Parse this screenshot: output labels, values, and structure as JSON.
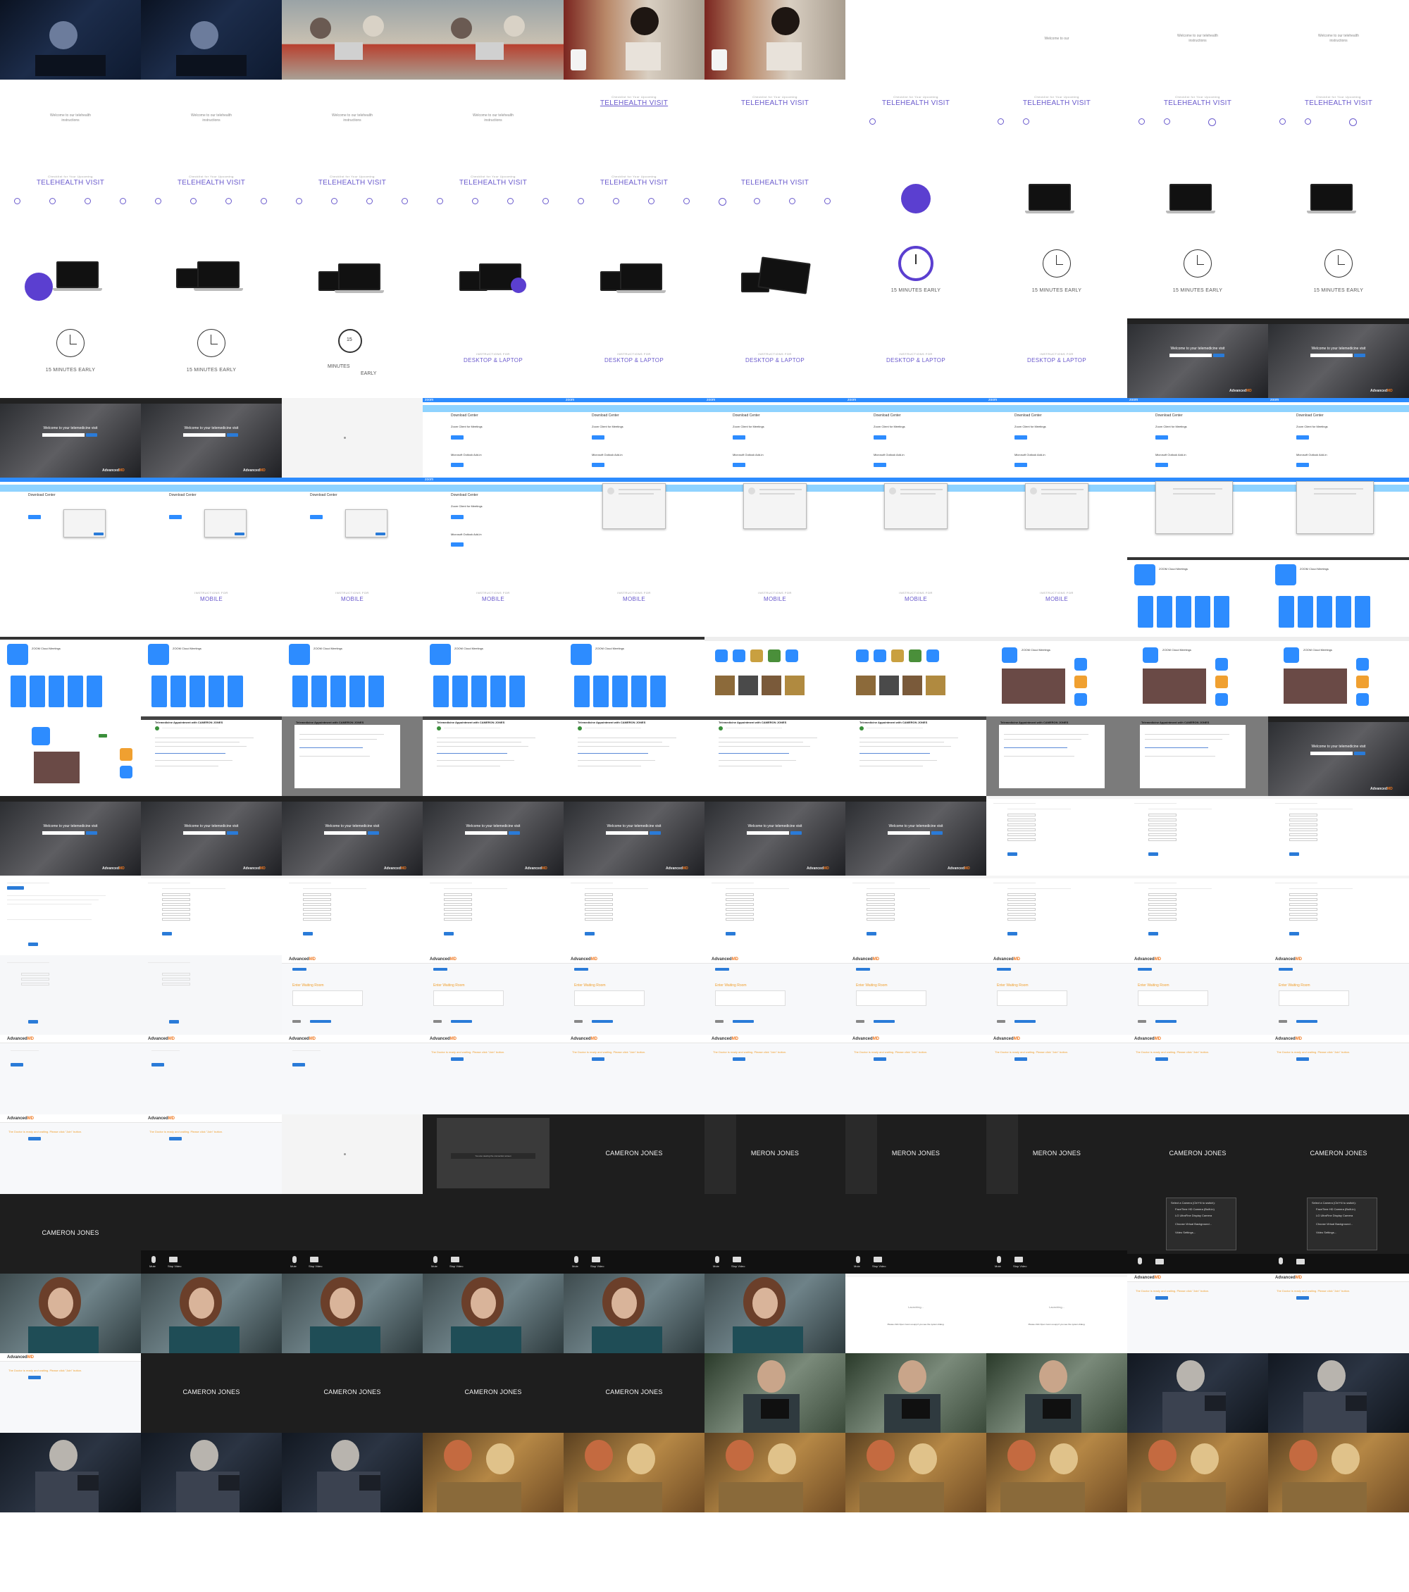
{
  "texts": {
    "welcome_short": "Welcome to our",
    "welcome_full": "Welcome to our telehealth instructions",
    "checklist_pre": "Checklist for Your Upcoming",
    "telehealth_visit": "TELEHEALTH VISIT",
    "fifteen_early": "15 MINUTES EARLY",
    "fifteen": "15",
    "minutes": "MINUTES",
    "early": "EARLY",
    "instructions_for": "INSTRUCTIONS FOR",
    "desktop_laptop": "DESKTOP & LAPTOP",
    "mobile": "MOBILE",
    "welcome_tele_site": "Welcome to your telemedicine visit",
    "zoom": "zoom",
    "download_center": "Download Center",
    "zoom_client": "Zoom Client for Meetings",
    "outlook_addin": "Microsoft Outlook Add-in",
    "zoom_cloud": "ZOOM Cloud Meetings",
    "appointment": "Telemedicine Appointment with CAMERON JONES",
    "advancedmd_a": "Advanced",
    "advancedmd_b": "MD",
    "enter_waiting_room": "Enter Waiting Room",
    "doctor_ready": "The Doctor is ready and waiting. Please click \"Join\" button.",
    "cameron_jones": "CAMERON JONES",
    "cameron_partial": "MERON JONES",
    "select_camera": "Select a Camera (Ctrl+N to switch):",
    "facetime": "FaceTime HD Camera (Built-in)",
    "lg_camera": "LG UltraFine Display Camera",
    "virtual_bg": "Choose Virtual Background...",
    "video_settings": "Video Settings...",
    "mute": "Mute",
    "stop_video": "Stop Video",
    "launching": "Launching...",
    "launch_hint": "Please click Open zoom.us.app if you see the system dialog.",
    "start_meeting_hint": "You are viewing the connection screen",
    "join": "Join"
  },
  "colors": {
    "accent_purple": "#6a5acd",
    "zoom_blue": "#2d8cff",
    "amd_orange": "#f07820",
    "dark_ui": "#1e1e1e"
  },
  "icons": [
    "check-circle-icon",
    "clock-icon",
    "laptop-icon",
    "phone-icon",
    "zoom-app-icon",
    "mic-icon",
    "video-camera-icon",
    "advancedmd-logo-icon"
  ],
  "grid": {
    "columns": 10,
    "frame_count": 191
  },
  "frames": [
    "night",
    "night",
    "office",
    "office",
    "asian",
    "asian",
    "blank",
    "welcome_short",
    "welcome",
    "welcome",
    "welcome",
    "welcome",
    "welcome",
    "welcome",
    "check0",
    "check1",
    "check2",
    "check3",
    "check4",
    "check4",
    "check5",
    "check5",
    "check5",
    "check5",
    "check5",
    "check6",
    "dot",
    "laptop",
    "laptop",
    "laptop",
    "laptop_blob",
    "laptop_blob2",
    "laptops",
    "laptops_blob",
    "laptops",
    "laptops_big",
    "clock_big",
    "clock",
    "clock",
    "clock",
    "clock",
    "clock",
    "clock_minutes",
    "instr_desk",
    "instr_desk",
    "instr_desk",
    "instr_desk",
    "instr_desk",
    "telesite",
    "telesite",
    "telesite",
    "telesite",
    "blank_dot",
    "zoomdl",
    "zoomdl",
    "zoomdl",
    "zoomdl",
    "zoomdl",
    "zoomdl",
    "zoomdl",
    "zoomdl_dlg",
    "zoomdl_dlg",
    "zoomdl_dlg",
    "zoomdl",
    "zoomdl_sheet",
    "zoomdl_sheet",
    "zoomdl_sheet",
    "zoomdl_sheet",
    "zoomdl_panel",
    "zoomdl_panel",
    "blank",
    "instr_mobile",
    "instr_mobile",
    "instr_mobile",
    "instr_mobile",
    "instr_mobile",
    "instr_mobile",
    "instr_mobile",
    "appstore",
    "appstore",
    "appstore",
    "appstore",
    "appstore",
    "appstore",
    "appstore",
    "gallery",
    "gallery",
    "gplay",
    "gplay",
    "gplay",
    "gplay_list",
    "email",
    "email_gray",
    "email",
    "email",
    "email",
    "email",
    "email_gray",
    "email_gray",
    "telesite",
    "telesite",
    "telesite",
    "telesite",
    "telesite",
    "telesite",
    "telesite",
    "telesite",
    "form",
    "form",
    "form",
    "form_side",
    "form",
    "form",
    "form",
    "form",
    "form",
    "form",
    "form",
    "form",
    "form",
    "form_faded",
    "form_faded",
    "amd_wait",
    "amd_wait",
    "amd_wait",
    "amd_wait",
    "amd_wait",
    "amd_wait",
    "amd_wait",
    "amd_wait",
    "amd_join",
    "amd_join",
    "amd_join",
    "amd_ready",
    "amd_ready",
    "amd_ready",
    "amd_ready",
    "amd_ready",
    "amd_ready",
    "amd_ready",
    "amd_ready",
    "amd_ready",
    "blank_dot",
    "zoom_conn",
    "zoom_name",
    "zoom_name_p",
    "zoom_name_p",
    "zoom_name_p",
    "zoom_name",
    "zoom_name",
    "zoom_name",
    "zoom_ctrl",
    "zoom_ctrl",
    "zoom_ctrl",
    "zoom_ctrl",
    "zoom_ctrl",
    "zoom_ctrl",
    "zoom_ctrl",
    "zoom_menu",
    "zoom_menu",
    "woman",
    "woman",
    "woman",
    "woman",
    "woman",
    "woman",
    "launch",
    "launch",
    "amd_ready",
    "amd_ready",
    "amd_ready",
    "zoom_name",
    "zoom_name",
    "zoom_name",
    "zoom_name",
    "glasses",
    "glasses",
    "glasses",
    "old",
    "old",
    "old",
    "old",
    "old",
    "family",
    "family",
    "family",
    "family",
    "family",
    "family",
    "family"
  ]
}
